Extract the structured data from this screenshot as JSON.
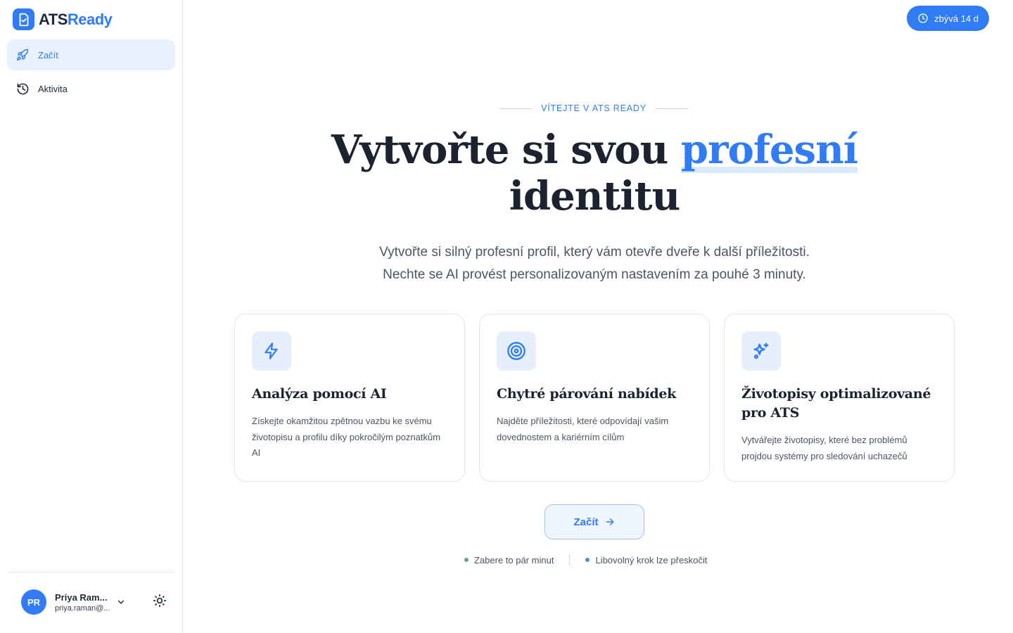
{
  "brand": {
    "name_plain": "ATS",
    "name_accent": "Ready",
    "logo_icon": "document-check-icon",
    "color": "#2f7cf6"
  },
  "sidebar": {
    "items": [
      {
        "label": "Začít",
        "icon": "rocket-icon",
        "active": true
      },
      {
        "label": "Aktivita",
        "icon": "history-icon",
        "active": false
      }
    ]
  },
  "user": {
    "initials": "PR",
    "name": "Priya Ram...",
    "email": "priya.raman@..."
  },
  "trial": {
    "label": "zbývá 14 d",
    "icon": "clock-icon"
  },
  "hero": {
    "eyebrow": "VÍTEJTE V ATS READY",
    "headline_start": "Vytvořte si svou ",
    "headline_highlight": "profesní",
    "headline_end": "identitu",
    "subtitle_line1": "Vytvořte si silný profesní profil, který vám otevře dveře k další příležitosti.",
    "subtitle_line2": "Nechte se AI provést personalizovaným nastavením za pouhé 3 minuty."
  },
  "cards": [
    {
      "icon": "lightning-icon",
      "title": "Analýza pomocí AI",
      "description": "Získejte okamžitou zpětnou vazbu ke svému životopisu a profilu díky pokročilým poznatkům AI"
    },
    {
      "icon": "target-icon",
      "title": "Chytré párování nabídek",
      "description": "Najděte příležitosti, které odpovídají vašim dovednostem a kariérním cílům"
    },
    {
      "icon": "sparkles-icon",
      "title": "Životopisy optimalizované pro ATS",
      "description": "Vytvářejte životopisy, které bez problémů projdou systémy pro sledování uchazečů"
    }
  ],
  "cta": {
    "label": "Začít",
    "icon": "arrow-right-icon"
  },
  "hints": [
    {
      "label": "Zabere to pár minut",
      "color": "#6b9e8a"
    },
    {
      "label": "Libovolný krok lze přeskočit",
      "color": "#4a90e2"
    }
  ]
}
